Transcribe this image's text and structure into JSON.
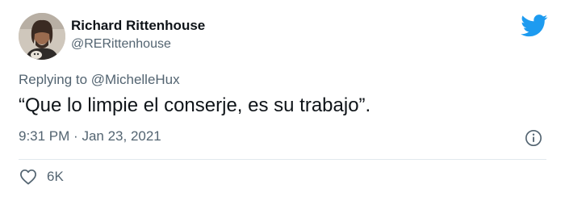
{
  "author": {
    "name": "Richard Rittenhouse",
    "handle": "@RERittenhouse"
  },
  "reply": {
    "prefix": "Replying to",
    "mention": "@MichelleHux"
  },
  "tweet_text": "“Que lo limpie el conserje, es su trabajo”.",
  "meta": {
    "time": "9:31 PM",
    "separator": "·",
    "date": "Jan 23, 2021"
  },
  "likes": {
    "count": "6K"
  },
  "icons": {
    "logo": "twitter-bird-icon",
    "info": "info-icon",
    "like": "heart-icon"
  },
  "colors": {
    "brand": "#1d9bf0",
    "text": "#0f1419",
    "secondary": "#536471"
  }
}
